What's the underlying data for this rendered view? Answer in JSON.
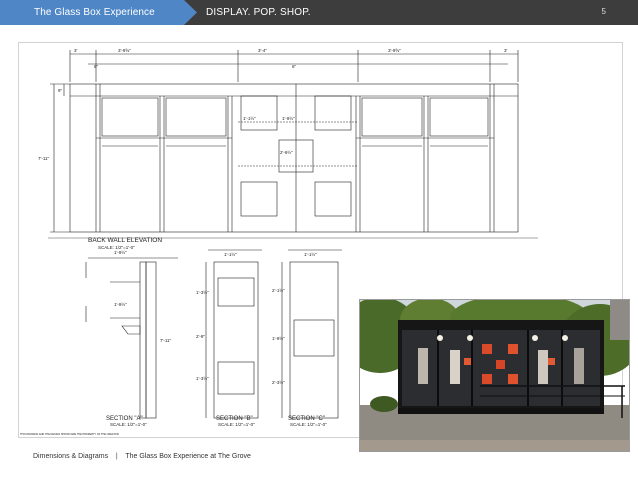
{
  "header": {
    "title": "The Glass Box Experience",
    "tagline": "DISPLAY. POP. SHOP.",
    "page_number": "5",
    "colors": {
      "bar": "#3d3d3d",
      "tab": "#4f86c6"
    }
  },
  "drawing": {
    "labels": {
      "elevation": "BACK WALL ELEVATION",
      "elevation_scale": "SCALE: 1/2\"=1'-0\"",
      "section_a": "SECTION \"A\"",
      "section_b": "SECTION \"B\"",
      "section_c": "SECTION \"C\"",
      "section_scale": "SCALE: 1/2\"=1'-0\""
    },
    "dimensions": {
      "top_a": "3'",
      "top_b": "3'-9⅝\"",
      "top_c": "3'-4\"",
      "top_d": "3'-9⅝\"",
      "top_e": "3'",
      "post_left": "6\"",
      "post_mid": "6\"",
      "height_total": "7'-11\"",
      "head": "9\"",
      "box_w": "1'-1½\"",
      "box_gap": "1'-9½\"",
      "box_v": "2'-9½\"",
      "sec_a_top": "1'-9½\"",
      "sec_a_mid": "1'-9½\"",
      "sec_a_h": "7'-11\"",
      "sec_b_top": "1'-1½\"",
      "sec_b_a": "1'-3½\"",
      "sec_b_b": "2'-9\"",
      "sec_b_c": "1'-3½\"",
      "sec_c_top": "1'-1½\"",
      "sec_c_a": "2'-1½\"",
      "sec_c_b": "1'-9½\"",
      "sec_c_c": "2'-3½\""
    },
    "footnote": "THIS DRAWING AND THE DESIGN SHOWN ARE THE PROPERTY OF THE CREATOR"
  },
  "photo": {
    "description_icon": "glass-box-storefront-photo"
  },
  "footer": {
    "left": "Dimensions & Diagrams",
    "separator": "|",
    "right": "The Glass Box Experience at The Grove"
  }
}
